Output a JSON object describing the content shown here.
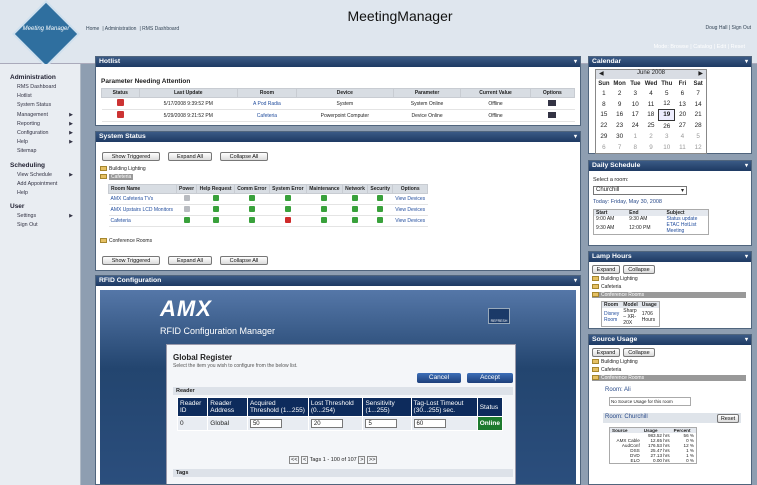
{
  "app": {
    "title": "MeetingManager",
    "logo_text": "Meeting Manager"
  },
  "breadcrumb": [
    "Home",
    "Administration",
    "RMS Dashboard"
  ],
  "user_links": "Doug Hall | Sign Out",
  "mode_bar": "Mode: Browse | Catalog | Edit | Reset",
  "nav": {
    "admin_header": "Administration",
    "admin_items": [
      "RMS Dashboard",
      "Hotlist",
      "System Status",
      "Management",
      "Reporting",
      "Configuration",
      "Help",
      "Sitemap"
    ],
    "sched_header": "Scheduling",
    "sched_items": [
      "View Schedule",
      "Add Appointment",
      "Help"
    ],
    "user_header": "User",
    "user_items": [
      "Settings",
      "Sign Out"
    ],
    "arrow": "▶"
  },
  "hotlist": {
    "title": "Hotlist",
    "subtitle": "Parameter Needing Attention",
    "columns": [
      "Status",
      "Last Update",
      "Room",
      "Device",
      "Parameter",
      "Current Value",
      "Options"
    ],
    "rows": [
      {
        "updated": "5/17/2008 9:39:52 PM",
        "room": "A Pod Radia",
        "device": "System",
        "parameter": "System Online",
        "value": "Offline"
      },
      {
        "updated": "5/29/2008 9:21:52 PM",
        "room": "Cafeteria",
        "device": "Powerpoint Computer",
        "parameter": "Device Online",
        "value": "Offline"
      }
    ]
  },
  "system_status": {
    "title": "System Status",
    "buttons": [
      "Show Triggered",
      "Expand All",
      "Collapse All"
    ],
    "folders": [
      "Building Lighting",
      "Cafeteria",
      "Conference Rooms"
    ],
    "columns": [
      "Room Name",
      "Power",
      "Help Request",
      "Comm Error",
      "System Error",
      "Maintenance",
      "Network",
      "Security",
      "Options"
    ],
    "rows": [
      {
        "name": "AMX Cafeteria TVs",
        "link": "View Devices"
      },
      {
        "name": "AMX Upstairs LCD Monitors",
        "link": "View Devices"
      },
      {
        "name": "Cafeteria",
        "link": "View Devices"
      }
    ]
  },
  "rfid": {
    "title": "RFID Configuration",
    "brand": "AMX",
    "manager_title": "RFID Configuration Manager",
    "refresh": "REFRESH",
    "register_title": "Global Register",
    "register_hint": "Select the item you wish to configure from the below list.",
    "cancel": "Cancel",
    "accept": "Accept",
    "reader_label": "Reader",
    "columns": [
      "Reader ID",
      "Reader Address",
      "Acquired Threshold (1...255)",
      "Lost Threshold (0...254)",
      "Sensitivity (1...255)",
      "Tag-Lost Timeout (30...255) sec.",
      "Status"
    ],
    "row": {
      "id": "0",
      "address": "Global",
      "acquired": "50",
      "lost": "20",
      "sensitivity": "5",
      "timeout": "60",
      "status": "Online"
    },
    "pager": "Tags 1 - 100 of 107",
    "tags_label": "Tags"
  },
  "calendar": {
    "title": "Calendar",
    "month": "June 2008",
    "days": [
      "Sun",
      "Mon",
      "Tue",
      "Wed",
      "Thu",
      "Fri",
      "Sat"
    ],
    "weeks": [
      [
        "1",
        "2",
        "3",
        "4",
        "5",
        "6",
        "7"
      ],
      [
        "8",
        "9",
        "10",
        "11",
        "12",
        "13",
        "14"
      ],
      [
        "15",
        "16",
        "17",
        "18",
        "19",
        "20",
        "21"
      ],
      [
        "22",
        "23",
        "24",
        "25",
        "26",
        "27",
        "28"
      ],
      [
        "29",
        "30",
        "1",
        "2",
        "3",
        "4",
        "5"
      ],
      [
        "6",
        "7",
        "8",
        "9",
        "10",
        "11",
        "12"
      ]
    ],
    "today": "19"
  },
  "daily": {
    "title": "Daily Schedule",
    "select_label": "Select a room:",
    "room": "Churchill",
    "date": "Today: Friday, May 30, 2008",
    "columns": [
      "Start",
      "End",
      "Subject"
    ],
    "rows": [
      {
        "start": "9:00 AM",
        "end": "9:30 AM",
        "subject": "Status update"
      },
      {
        "start": "9:30 AM",
        "end": "12:00 PM",
        "subject": "ETAC HotList Meeting"
      }
    ]
  },
  "lamp": {
    "title": "Lamp Hours",
    "expand": "Expand",
    "collapse": "Collapse",
    "folders": [
      "Building Lighting",
      "Cafeteria",
      "Conference Rooms"
    ],
    "columns": [
      "Room",
      "Model",
      "Usage"
    ],
    "row": {
      "room": "Disney Room",
      "model": "Sharp – XR-20X",
      "usage": "1706 Hours"
    }
  },
  "source": {
    "title": "Source Usage",
    "expand": "Expand",
    "collapse": "Collapse",
    "folders": [
      "Building Lighting",
      "Cafeteria",
      "Conference Rooms"
    ],
    "room1": "Room: Ali",
    "no_usage": "No Source Usage for this room",
    "room2": "Room: Churchill",
    "reset": "Reset",
    "columns": [
      "Source",
      "Usage",
      "Percent"
    ],
    "rows": [
      {
        "source": "",
        "usage": "983.52 hrs",
        "pct": "56 %"
      },
      {
        "source": "AMX Cable",
        "usage": "12.65 hrs",
        "pct": "0 %"
      },
      {
        "source": "AudConf",
        "usage": "176.53 hrs",
        "pct": "12 %"
      },
      {
        "source": "DSS",
        "usage": "25.47 hrs",
        "pct": "1 %"
      },
      {
        "source": "DVD",
        "usage": "27.13 hrs",
        "pct": "1 %"
      },
      {
        "source": "ELO",
        "usage": "0.00 hrs",
        "pct": "0 %"
      }
    ]
  }
}
